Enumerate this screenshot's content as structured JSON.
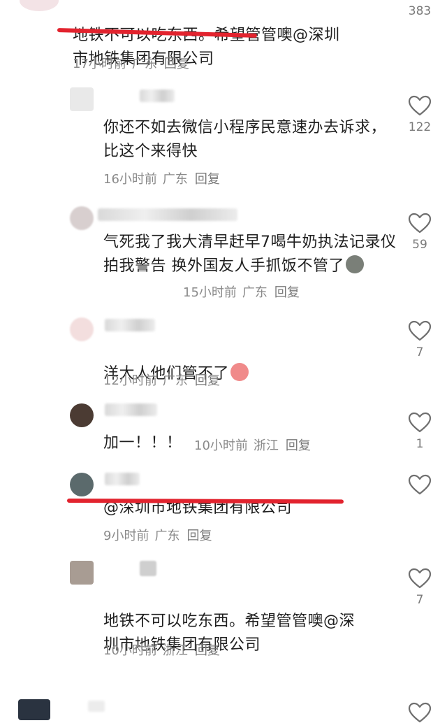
{
  "comments": [
    {
      "text": "地铁不可以吃东西。希望管管噢@深圳市地铁集团有限公司",
      "time": "17小时前",
      "region": "广东",
      "reply": "回复",
      "likes": "383"
    },
    {
      "text": "你还不如去微信小程序民意速办去诉求，比这个来得快",
      "time": "16小时前",
      "region": "广东",
      "reply": "回复",
      "likes": "122"
    },
    {
      "text": "气死我了我大清早赶早7喝牛奶执法记录仪拍我警告 换外国友人手抓饭不管了",
      "time": "15小时前",
      "region": "广东",
      "reply": "回复",
      "likes": "59"
    },
    {
      "text": "洋大人他们管不了",
      "time": "12小时前",
      "region": "广东",
      "reply": "回复",
      "likes": "7"
    },
    {
      "text": "加一！！！",
      "time": "10小时前",
      "region": "浙江",
      "reply": "回复",
      "likes": "1"
    },
    {
      "text": "@深圳市地铁集团有限公司",
      "time": "9小时前",
      "region": "广东",
      "reply": "回复",
      "likes": ""
    },
    {
      "text": "地铁不可以吃东西。希望管管噢@深圳市地铁集团有限公司",
      "time": "10小时前",
      "region": "浙江",
      "reply": "回复",
      "likes": "7"
    }
  ],
  "colors": {
    "underline": "#e2232e",
    "meta": "#8a8a8a",
    "text": "#1f1f1f"
  }
}
